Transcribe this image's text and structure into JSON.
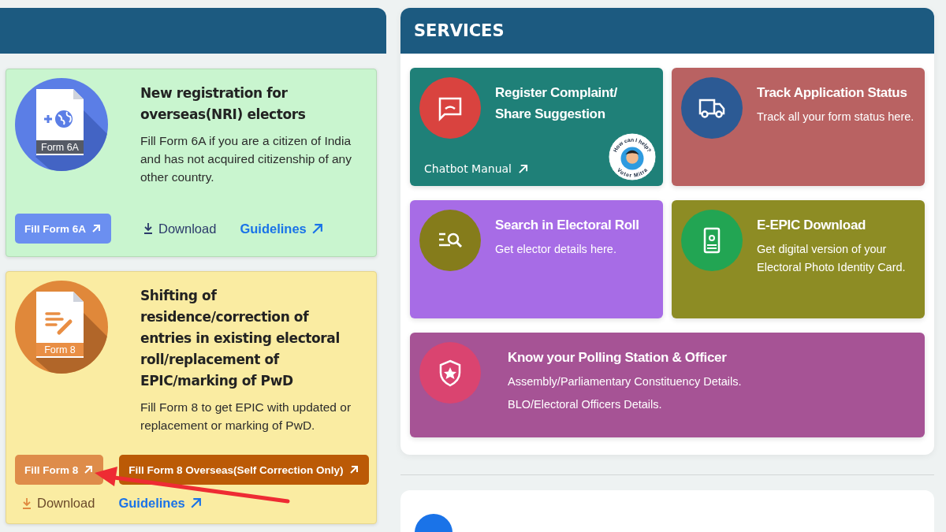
{
  "forms": [
    {
      "kind": "form6a",
      "icon_label": "Form 6A",
      "title": "New registration for overseas(NRI) electors",
      "description": "Fill Form 6A if you are a citizen of India and has not acquired citizenship of any other country.",
      "buttons": [
        {
          "label": "Fill Form 6A",
          "kind": "light"
        }
      ],
      "links": [
        {
          "label": "Download",
          "kind": "download"
        },
        {
          "label": "Guidelines",
          "kind": "external"
        }
      ]
    },
    {
      "kind": "form8",
      "icon_label": "Form 8",
      "title": "Shifting of residence/correction of entries in existing electoral roll/replacement of EPIC/marking of PwD",
      "description": "Fill Form 8 to get EPIC with updated or replacement or marking of PwD.",
      "buttons": [
        {
          "label": "Fill Form 8",
          "kind": "light"
        },
        {
          "label": "Fill Form 8 Overseas(Self Correction Only)",
          "kind": "dark"
        }
      ],
      "links": [
        {
          "label": "Download",
          "kind": "download"
        },
        {
          "label": "Guidelines",
          "kind": "external"
        }
      ]
    }
  ],
  "services": {
    "title": "SERVICES",
    "items": [
      {
        "kind": "complaint",
        "title": "Register Complaint/ Share Suggestion",
        "link": "Chatbot Manual",
        "badge": {
          "top": "How can I help?",
          "bottom": "Voter Mitra"
        }
      },
      {
        "kind": "track",
        "title": "Track Application Status",
        "lines": [
          "Track all your form status here."
        ]
      },
      {
        "kind": "search",
        "title": "Search in Electoral Roll",
        "lines": [
          "Get elector details here."
        ]
      },
      {
        "kind": "epic",
        "title": "E-EPIC Download",
        "lines": [
          "Get digital version of your Electoral Photo Identity Card."
        ]
      },
      {
        "kind": "polling",
        "title": "Know your Polling Station & Officer",
        "lines": [
          "Assembly/Parliamentary Constituency Details.",
          "BLO/Electoral Officers Details."
        ]
      }
    ]
  }
}
